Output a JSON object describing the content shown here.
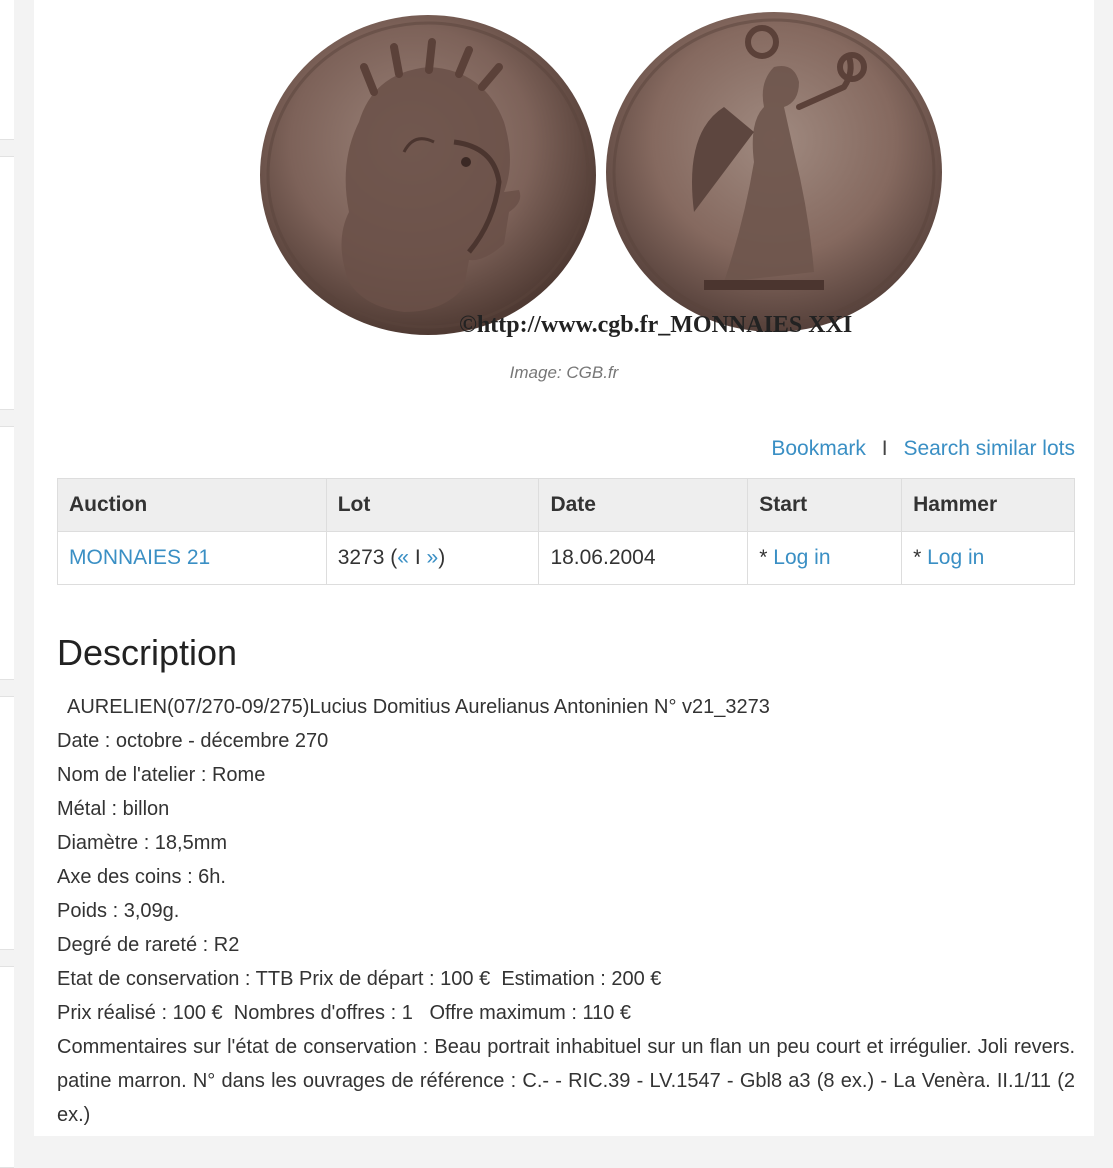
{
  "image": {
    "watermark": "©http://www.cgb.fr_MONNAIES XXI",
    "caption": "Image: CGB.fr"
  },
  "actions": {
    "bookmark": "Bookmark",
    "separator": "I",
    "search_similar": "Search similar lots"
  },
  "table": {
    "headers": [
      "Auction",
      "Lot",
      "Date",
      "Start",
      "Hammer"
    ],
    "row": {
      "auction": "MONNAIES 21",
      "lot_number": "3273",
      "lot_open": "(",
      "lot_prev": "«",
      "lot_sep": "I",
      "lot_next": "»",
      "lot_close": ")",
      "date": "18.06.2004",
      "start_prefix": "* ",
      "start_link": "Log in",
      "hammer_prefix": "* ",
      "hammer_link": "Log in"
    }
  },
  "description": {
    "title": "Description",
    "lines": [
      "  AURELIEN(07/270-09/275)Lucius Domitius Aurelianus Antoninien N° v21_3273",
      "Date : octobre - décembre 270",
      "Nom de l'atelier : Rome",
      "Métal : billon",
      "Diamètre : 18,5mm",
      "Axe des coins : 6h.",
      "Poids : 3,09g.",
      "Degré de rareté : R2",
      "Etat de conservation : TTB Prix de départ : 100 €  Estimation : 200 €",
      "Prix réalisé : 100 €  Nombres d'offres : 1   Offre maximum : 110 €"
    ],
    "comment": "Commentaires sur l'état de conservation : Beau portrait inhabituel sur un flan un peu court et irrégulier. Joli revers. patine marron. N° dans les ouvrages de référence : C.-  - RIC.39  - LV.1547  - Gbl8 a3 (8 ex.) - La Venèra. II.1/11 (2 ex.)"
  }
}
